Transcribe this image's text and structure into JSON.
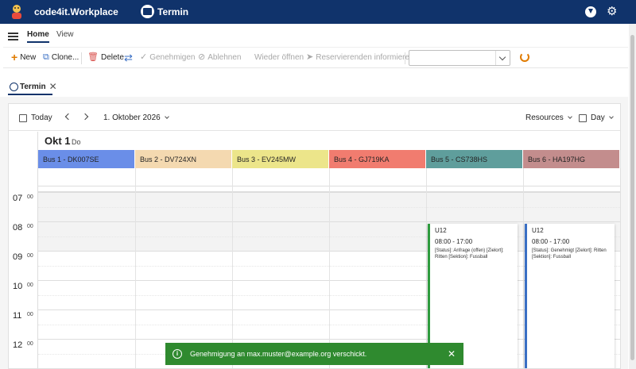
{
  "app": {
    "title": "code4it.Workplace",
    "module": "Termin"
  },
  "ribbon": {
    "tabs": [
      "Home",
      "View"
    ]
  },
  "toolbar": {
    "new": "New",
    "clone": "Clone...",
    "delete": "Delete",
    "approve": "Genehmigen",
    "reject": "Ablehnen",
    "reopen": "Wieder öffnen",
    "inform": "Reservierenden informieren",
    "select_value": ""
  },
  "doc_tab": {
    "label": "Termin"
  },
  "calendar": {
    "today": "Today",
    "date_picker": "1. Oktober 2026",
    "resources": "Resources",
    "view": "Day",
    "date_label": "Okt 1",
    "day_of_week": "Do",
    "resources_list": [
      {
        "name": "Bus 1 - DK007SE",
        "color": "#6a8ee8"
      },
      {
        "name": "Bus 2 - DV724XN",
        "color": "#f4d9b0"
      },
      {
        "name": "Bus 3 - EV245MW",
        "color": "#ece58a"
      },
      {
        "name": "Bus 4 - GJ719KA",
        "color": "#f17c6f"
      },
      {
        "name": "Bus 5 - CS738HS",
        "color": "#5f9e9c"
      },
      {
        "name": "Bus 6 - HA197HG",
        "color": "#c38d8d"
      }
    ],
    "hours": [
      {
        "h": "07",
        "m": "00"
      },
      {
        "h": "08",
        "m": "00"
      },
      {
        "h": "09",
        "m": "00"
      },
      {
        "h": "10",
        "m": "00"
      },
      {
        "h": "11",
        "m": "00"
      },
      {
        "h": "12",
        "m": "00"
      }
    ],
    "events": [
      {
        "resource": 4,
        "title": "U12",
        "time": "08:00 - 17:00",
        "desc": "[Status]: Anfrage (offen) [Zielort]: Ritten [Sektion]: Fussball",
        "color": "#2e9b3e"
      },
      {
        "resource": 5,
        "title": "U12",
        "time": "08:00 - 17:00",
        "desc": "[Status]: Genehmigt [Zielort]: Ritten [Sektion]: Fussball",
        "color": "#3a6fc4"
      }
    ]
  },
  "toast": {
    "message": "Genehmigung an max.muster@example.org verschickt."
  }
}
